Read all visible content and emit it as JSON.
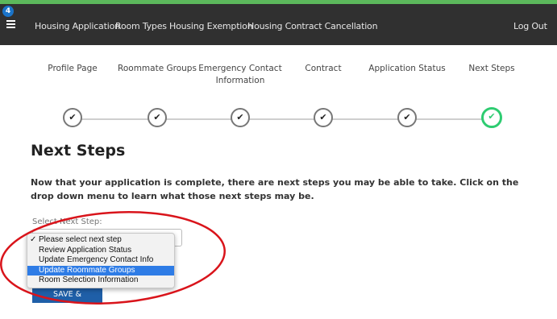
{
  "navbar": {
    "badge_count": "4",
    "links": [
      "Housing Application",
      "Room Types",
      "Housing Exemption",
      "Housing Contract Cancellation"
    ],
    "logout": "Log Out"
  },
  "steps": [
    {
      "label": "Profile Page",
      "status": "complete"
    },
    {
      "label": "Roommate Groups",
      "status": "complete"
    },
    {
      "label": "Emergency Contact Information",
      "status": "complete"
    },
    {
      "label": "Contract",
      "status": "complete"
    },
    {
      "label": "Application Status",
      "status": "complete"
    },
    {
      "label": "Next Steps",
      "status": "current"
    }
  ],
  "check_glyph": "✔",
  "main": {
    "title": "Next Steps",
    "intro": "Now that your application is complete, there are next steps you may be able to take. Click on the drop down menu to learn what those next steps may be.",
    "select_label": "Select Next Step:",
    "save_button": "SAVE & CONTINUE"
  },
  "dropdown": {
    "options": [
      {
        "label": "Please select next step",
        "checked": true,
        "highlighted": false
      },
      {
        "label": "Review Application Status",
        "checked": false,
        "highlighted": false
      },
      {
        "label": "Update Emergency Contact Info",
        "checked": false,
        "highlighted": false
      },
      {
        "label": "Update Roommate Groups",
        "checked": false,
        "highlighted": true
      },
      {
        "label": "Room Selection Information",
        "checked": false,
        "highlighted": false
      }
    ]
  },
  "colors": {
    "accent_green": "#2ecc71",
    "highlight_blue": "#2e7ce6",
    "annotation_red": "#d9141b",
    "navbar_bg": "#303030"
  }
}
